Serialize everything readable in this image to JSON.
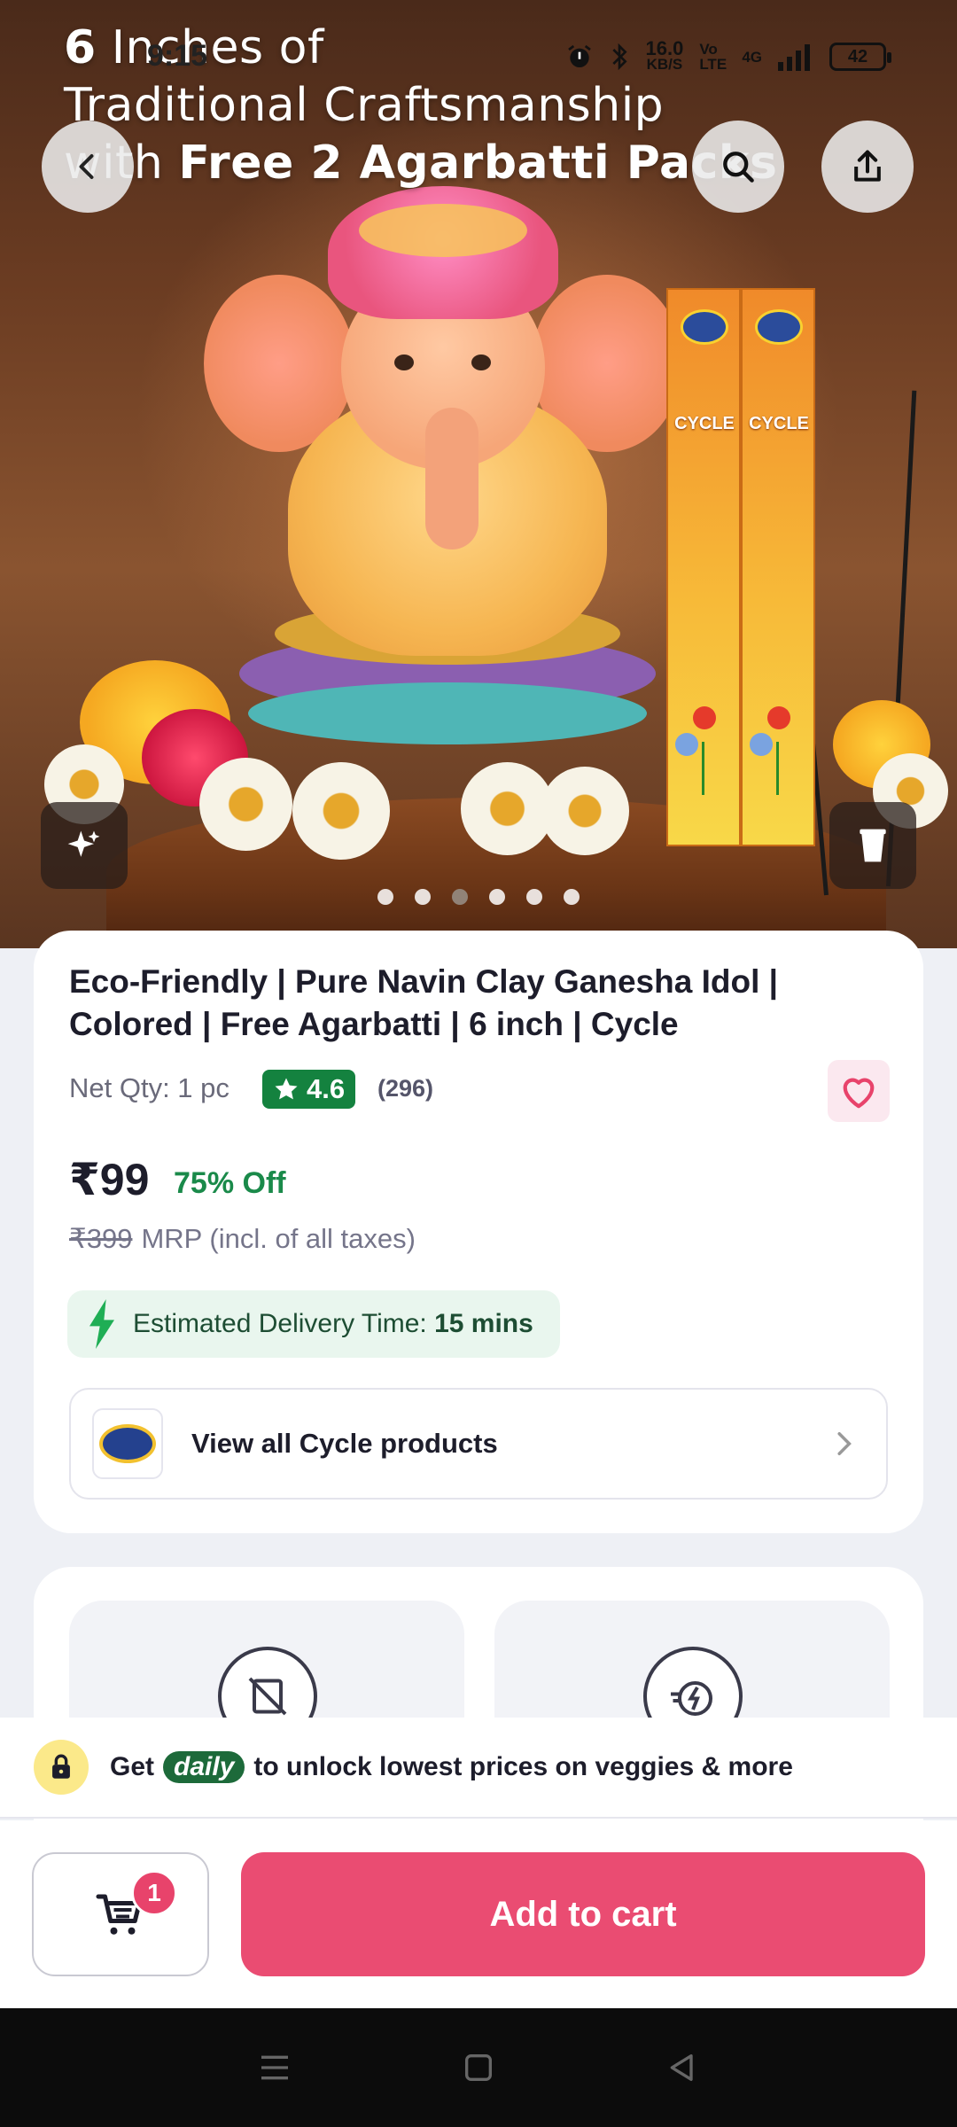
{
  "status_bar": {
    "time": "9:15",
    "net_speed_value": "16.0",
    "net_speed_unit": "KB/S",
    "volte": "Vo LTE",
    "network": "4G",
    "battery": "42"
  },
  "hero": {
    "title_line1_bold": "6",
    "title_line1": " Inches of",
    "title_line2": "Traditional Craftsmanship",
    "title_line3": "with ",
    "title_line3_bold": "Free 2 Agarbatti Packs",
    "box_brand": "CYCLE",
    "carousel_dots": 6,
    "active_dot": 2
  },
  "product": {
    "title": "Eco-Friendly | Pure Navin Clay Ganesha Idol | Colored | Free Agarbatti | 6 inch | Cycle",
    "net_qty": "Net Qty: 1 pc",
    "rating": "4.6",
    "rating_count": "(296)",
    "price": "₹99",
    "discount": "75% Off",
    "mrp_value": "₹399",
    "mrp_label": "MRP (incl. of all taxes)",
    "eta_label": "Estimated Delivery Time: ",
    "eta_value": "15 mins",
    "brand_link": "View all Cycle products"
  },
  "daily_banner": {
    "prefix": "Get",
    "badge": "daily",
    "suffix": "to unlock lowest prices on veggies & more"
  },
  "bottom_bar": {
    "cart_count": "1",
    "add_to_cart": "Add to cart"
  },
  "colors": {
    "accent": "#ea4c72",
    "rating_green": "#14823f",
    "discount_green": "#1a8a4a"
  }
}
